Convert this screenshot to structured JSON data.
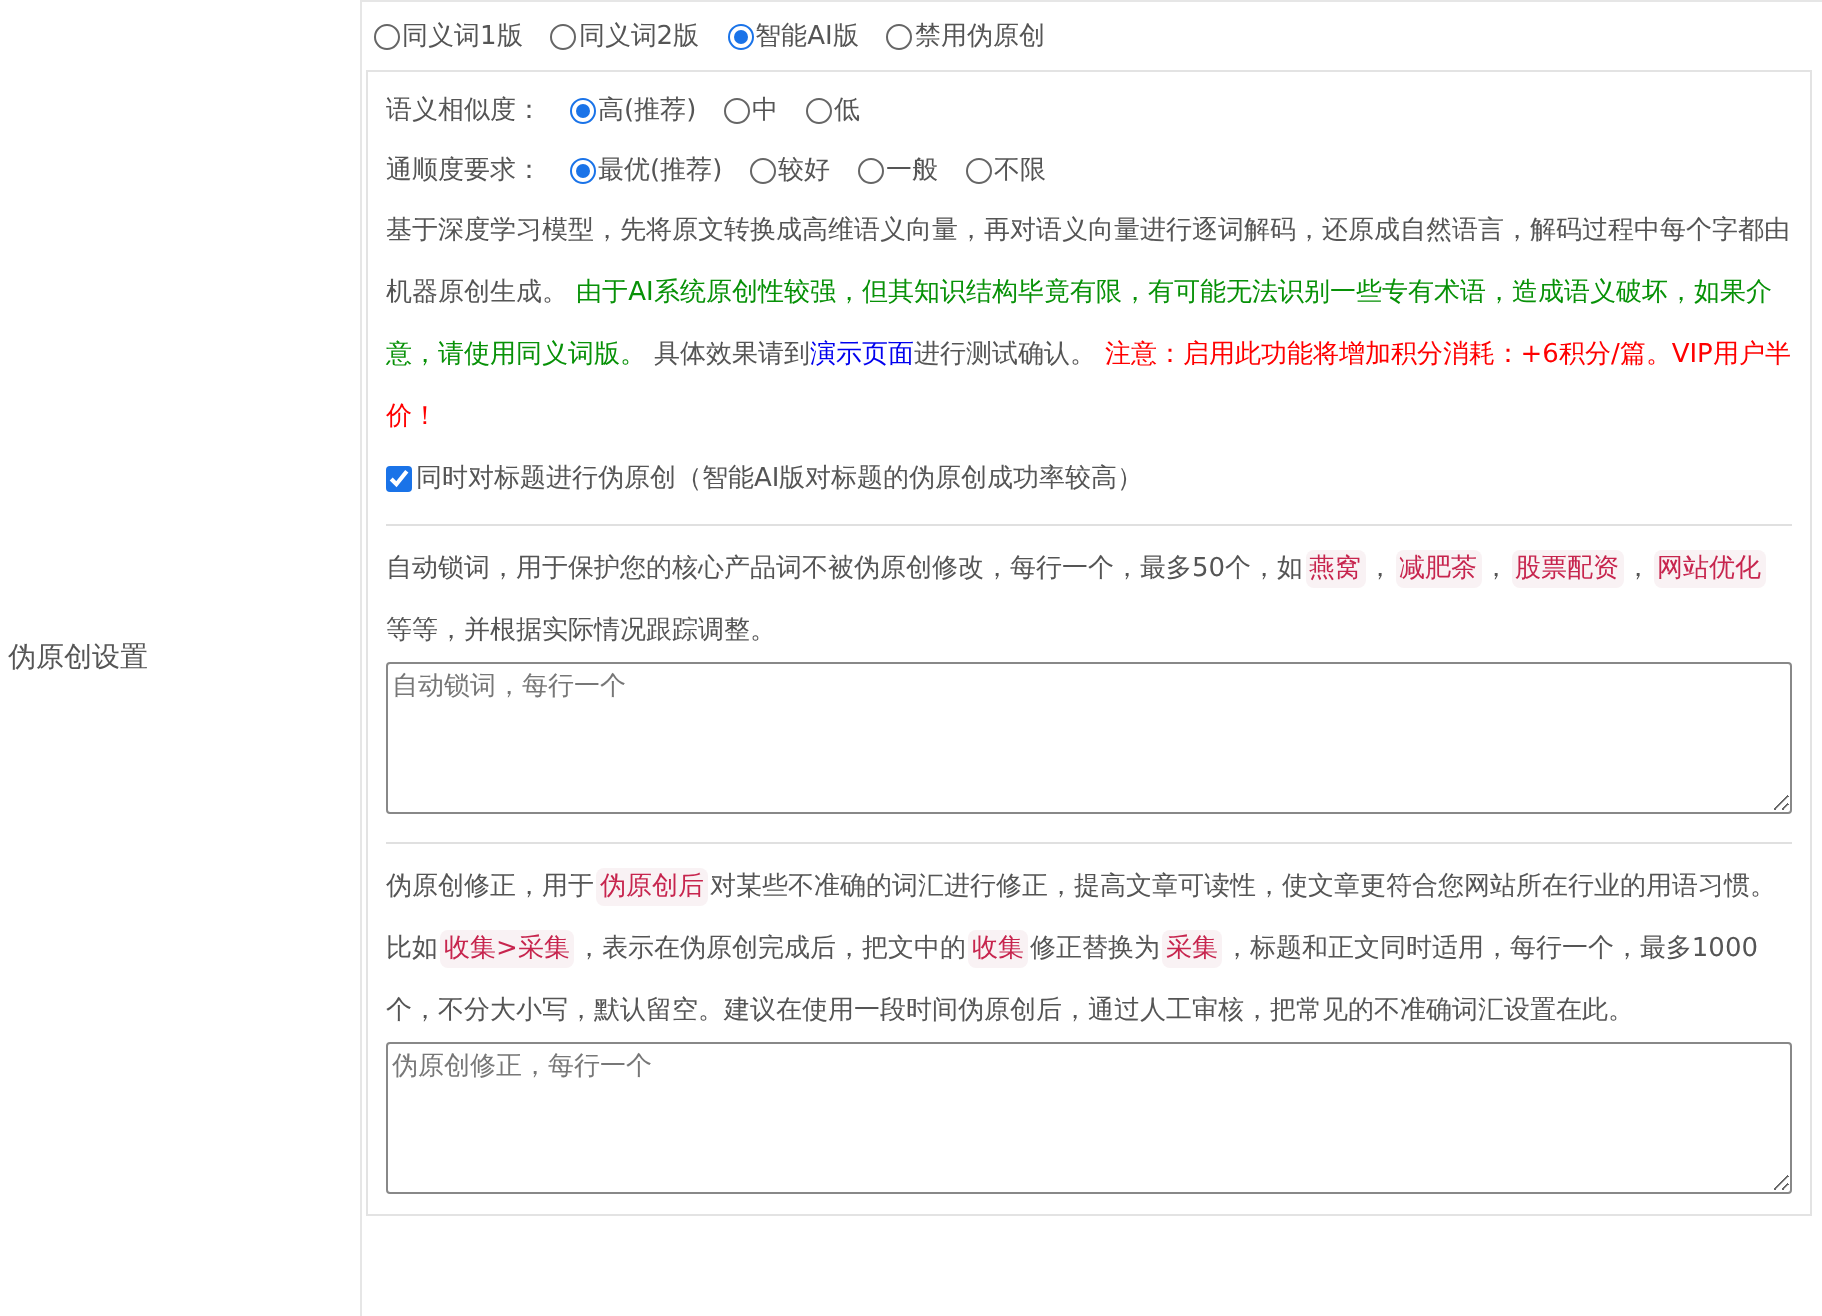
{
  "label": "伪原创设置",
  "modes": [
    {
      "label": "同义词1版",
      "selected": false
    },
    {
      "label": "同义词2版",
      "selected": false
    },
    {
      "label": "智能AI版",
      "selected": true
    },
    {
      "label": "禁用伪原创",
      "selected": false
    }
  ],
  "similarity": {
    "label": "语义相似度：",
    "options": [
      {
        "label": "高(推荐)",
        "selected": true
      },
      {
        "label": "中",
        "selected": false
      },
      {
        "label": "低",
        "selected": false
      }
    ]
  },
  "fluency": {
    "label": "通顺度要求：",
    "options": [
      {
        "label": "最优(推荐)",
        "selected": true
      },
      {
        "label": "较好",
        "selected": false
      },
      {
        "label": "一般",
        "selected": false
      },
      {
        "label": "不限",
        "selected": false
      }
    ]
  },
  "ai_description": [
    {
      "kind": "text",
      "text": "基于深度学习模型，先将原文转换成高维语义向量，再对语义向量进行逐词解码，还原成自然语言，解码过程中每个字都由机器原创生成。 "
    },
    {
      "kind": "note",
      "text": "由于AI系统原创性较强，但其知识结构毕竟有限，有可能无法识别一些专有术语，造成语义破坏，如果介意，请使用同义词版。"
    },
    {
      "kind": "text",
      "text": " 具体效果请到"
    },
    {
      "kind": "link",
      "text": "演示页面"
    },
    {
      "kind": "text",
      "text": "进行测试确认。 "
    },
    {
      "kind": "warning",
      "text": "注意：启用此功能将增加积分消耗：+6积分/篇。VIP用户半价！"
    }
  ],
  "title_option": {
    "label": "同时对标题进行伪原创（智能AI版对标题的伪原创成功率较高）",
    "checked": true
  },
  "lock_words": {
    "description": [
      {
        "kind": "text",
        "text": "自动锁词，用于保护您的核心产品词不被伪原创修改，每行一个，最多50个，如"
      },
      {
        "kind": "tag",
        "text": "燕窝"
      },
      {
        "kind": "text",
        "text": "，"
      },
      {
        "kind": "tag",
        "text": "减肥茶"
      },
      {
        "kind": "text",
        "text": "，"
      },
      {
        "kind": "tag",
        "text": "股票配资"
      },
      {
        "kind": "text",
        "text": "，"
      },
      {
        "kind": "tag",
        "text": "网站优化"
      },
      {
        "kind": "text",
        "text": "等等，并根据实际情况跟踪调整。"
      }
    ],
    "placeholder": "自动锁词，每行一个"
  },
  "corrections": {
    "description": [
      {
        "kind": "text",
        "text": "伪原创修正，用于"
      },
      {
        "kind": "tag",
        "text": "伪原创后"
      },
      {
        "kind": "text",
        "text": "对某些不准确的词汇进行修正，提高文章可读性，使文章更符合您网站所在行业的用语习惯。比如"
      },
      {
        "kind": "tag",
        "text": "收集>采集"
      },
      {
        "kind": "text",
        "text": "，表示在伪原创完成后，把文中的"
      },
      {
        "kind": "tag",
        "text": "收集"
      },
      {
        "kind": "text",
        "text": "修正替换为"
      },
      {
        "kind": "tag",
        "text": "采集"
      },
      {
        "kind": "text",
        "text": "，标题和正文同时适用，每行一个，最多1000个，不分大小写，默认留空。建议在使用一段时间伪原创后，通过人工审核，把常见的不准确词汇设置在此。"
      }
    ],
    "placeholder": "伪原创修正，每行一个"
  }
}
